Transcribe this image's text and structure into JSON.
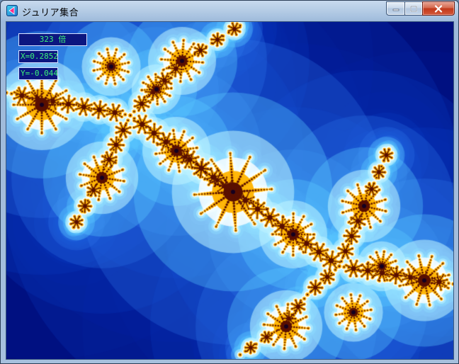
{
  "window": {
    "title": "ジュリア集合",
    "app_icon": "julia-app-icon"
  },
  "caption_buttons": [
    {
      "name": "minimize",
      "icon": "minimize-icon"
    },
    {
      "name": "maximize",
      "icon": "maximize-icon"
    },
    {
      "name": "close",
      "icon": "close-icon"
    }
  ],
  "overlay": {
    "zoom": "323 倍",
    "x": "X=0.2852",
    "y": "Y=-0.0441"
  },
  "colors": {
    "background": "#00086e",
    "glow": "#59c8ff",
    "core": "#ffb400",
    "readout_text": "#3cf27a"
  }
}
